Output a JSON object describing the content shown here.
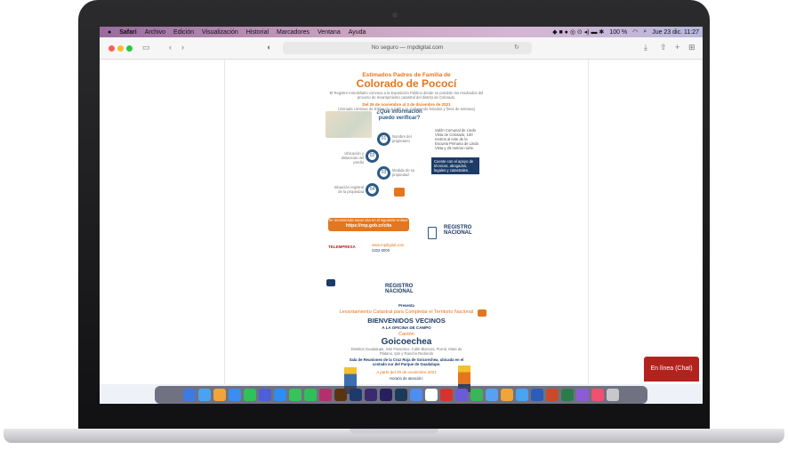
{
  "menubar": {
    "apple": "",
    "items": [
      "Safari",
      "Archivo",
      "Edición",
      "Visualización",
      "Historial",
      "Marcadores",
      "Ventana",
      "Ayuda"
    ],
    "battery": "100 %",
    "clock": "Jue 23 dic.  11:27"
  },
  "toolbar": {
    "url": "No seguro — rnpdigital.com",
    "back": "‹",
    "forward": "›",
    "add_tab": "+"
  },
  "flyer1": {
    "heading": "Estimados Padres de Familia de",
    "place": "Colorado de Pococí",
    "intro": "El Registro Inmobiliario convoca a la Exposición Pública donde se pondrán los resultados del proceso de levantamiento catastral del distrito de Colorado.",
    "dates": "Del 26 de noviembre al 3 de diciembre de 2021",
    "hours": "(Jornada continua de 8:00 a.m. a 4:00 p.m. incluyendo feriados y fines de semana)",
    "question": "¿Qué información puedo verificar?",
    "items": [
      "Nombre del propietario",
      "Ubicación y distancias del predio",
      "Medida de su propiedad",
      "Situación registral de la propiedad",
      "Planos catastrados"
    ],
    "venue": "Salón Comunal de Linda Vista de Colorado, 100 metros al este de la Escuela Primaria de Linda Vista y 25 metros norte.",
    "support": "Cuente con el apoyo de técnicos, abogados, legales y catastrales.",
    "link_label": "Se recomienda sacar cita en el siguiente enlace:",
    "link": "https://rnp.gob.cr/cita",
    "contact": "www.rnpdigital.com",
    "phone": "2202-0000",
    "logo": "REGISTRO NACIONAL",
    "tele": "TELEMPRESA"
  },
  "flyer2": {
    "logo": "REGISTRO NACIONAL",
    "presents": "Presenta",
    "project": "Levantamiento Catastral para Completar el Territorio Nacional",
    "welcome": "BIENVENIDOS VECINOS",
    "office": "A LA OFICINA DE CAMPO",
    "canton_label": "Cantón",
    "canton": "Goicoechea",
    "districts": "Distritos Guadalupe, San Francisco, Calle Blancos, Purral, Mata de Plátano, Ipís y Rancho Redondo",
    "venue": "Sala de Reuniones de la Cruz Roja de Goicoechea, ubicada en el costado sur del Parque de Guadalupe.",
    "from": "A partir del 29 de noviembre 2021",
    "schedule_label": "Horario de atención:",
    "days": "Lunes a Viernes de",
    "hours": "7 a.m. a 4 p.m."
  },
  "chat": {
    "label": "En línea (Chat)"
  },
  "colors": {
    "orange": "#e4761d",
    "navy": "#1c3b67",
    "chat": "#b2231e"
  }
}
